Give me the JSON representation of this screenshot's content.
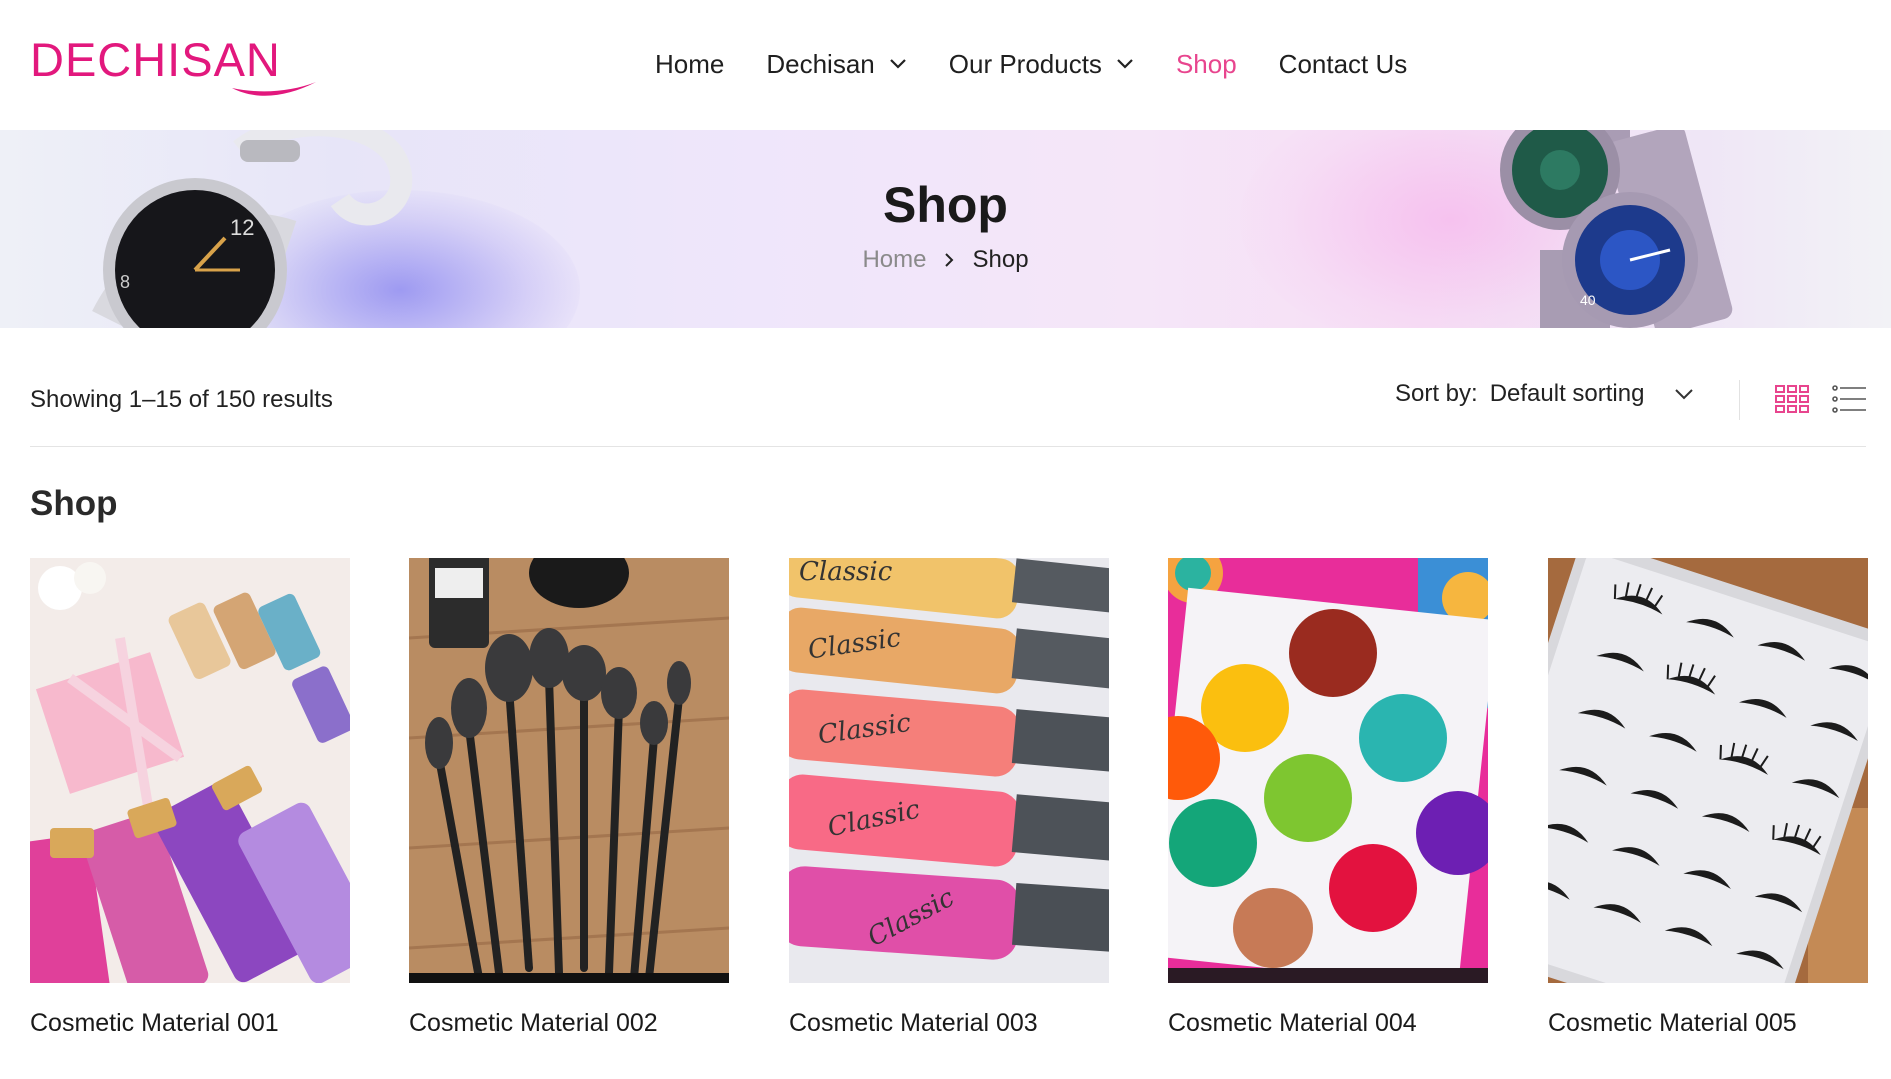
{
  "brand": {
    "logo_text": "DECHISAN",
    "accent_color": "#e2187d"
  },
  "nav": {
    "items": [
      {
        "label": "Home",
        "dropdown": false,
        "active": false
      },
      {
        "label": "Dechisan",
        "dropdown": true,
        "active": false
      },
      {
        "label": "Our Products",
        "dropdown": true,
        "active": false
      },
      {
        "label": "Shop",
        "dropdown": false,
        "active": true
      },
      {
        "label": "Contact Us",
        "dropdown": false,
        "active": false
      }
    ]
  },
  "banner": {
    "title": "Shop",
    "breadcrumb": {
      "home": "Home",
      "current": "Shop"
    }
  },
  "toolbar": {
    "result_count": "Showing 1–15 of 150 results",
    "sort_label": "Sort by:",
    "sort_value": "Default sorting",
    "view_mode": "grid"
  },
  "section_title": "Shop",
  "products": [
    {
      "name": "Cosmetic Material 001",
      "image": "perfume-mist-bottles"
    },
    {
      "name": "Cosmetic Material 002",
      "image": "makeup-brush-set"
    },
    {
      "name": "Cosmetic Material 003",
      "image": "lip-gloss-tubes"
    },
    {
      "name": "Cosmetic Material 004",
      "image": "eyeshadow-palette"
    },
    {
      "name": "Cosmetic Material 005",
      "image": "false-eyelash-tray"
    }
  ]
}
